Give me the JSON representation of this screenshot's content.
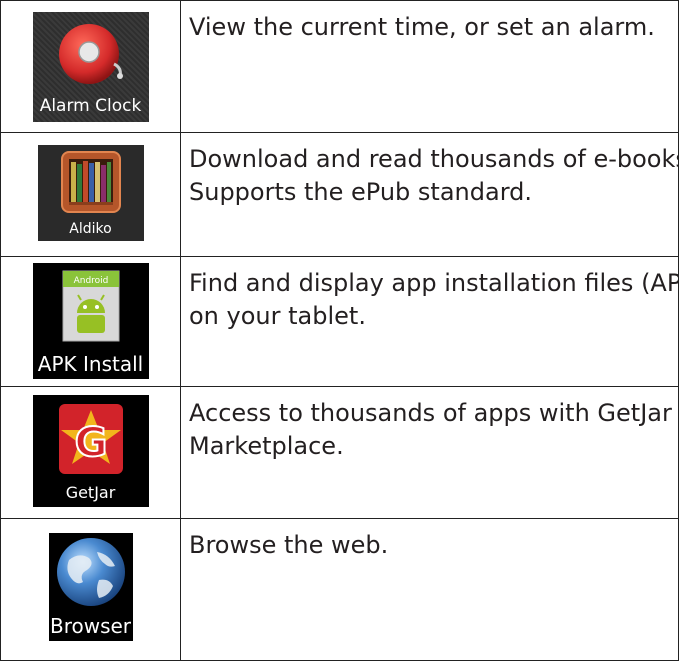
{
  "apps": [
    {
      "icon": "alarm-clock-icon",
      "label": "Alarm Clock",
      "description": "View the current time, or set an alarm."
    },
    {
      "icon": "aldiko-bookshelf-icon",
      "label": "Aldiko",
      "description": "Download and read thousands of e-books.\nSupports the ePub standard."
    },
    {
      "icon": "apk-install-android-icon",
      "label": "APK Install",
      "description": "Find and display app installation files (APKs)\non your tablet."
    },
    {
      "icon": "getjar-g-icon",
      "label": "GetJar",
      "description": "Access to thousands of apps with GetJar\nMarketplace."
    },
    {
      "icon": "browser-globe-icon",
      "label": "Browser",
      "description": "Browse the web."
    }
  ],
  "apk_badge_text": "Android",
  "getjar_letter": "G",
  "colors": {
    "alarm_red": "#d42a2a",
    "aldiko_wood": "#b5562a",
    "android_green": "#97c024",
    "getjar_red": "#d2232a",
    "getjar_gold": "#f2b51c",
    "globe_blue": "#2f6fb5"
  }
}
